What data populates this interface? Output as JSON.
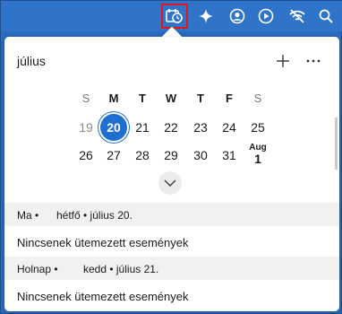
{
  "taskbar": {
    "icons": [
      "calendar-icon",
      "sparkle-icon",
      "account-icon",
      "play-icon",
      "wifi-icon",
      "search-icon"
    ],
    "highlight_color": "#e4161c"
  },
  "calendar": {
    "month_title": "július",
    "weekdays": [
      "S",
      "M",
      "T",
      "W",
      "T",
      "F",
      "S"
    ],
    "week1": [
      "19",
      "20",
      "21",
      "22",
      "23",
      "24",
      "25"
    ],
    "week2": [
      "26",
      "27",
      "28",
      "29",
      "30",
      "31"
    ],
    "next_month_label": "Aug",
    "next_month_day": "1",
    "today": "20",
    "accent_color": "#1f6fd0"
  },
  "agenda": {
    "day1": {
      "relative": "Ma •",
      "date": "hétfő • július 20.",
      "empty_text": "Nincsenek ütemezett események"
    },
    "day2": {
      "relative": "Holnap •",
      "date": "kedd • július 21.",
      "empty_text": "Nincsenek ütemezett események"
    }
  }
}
